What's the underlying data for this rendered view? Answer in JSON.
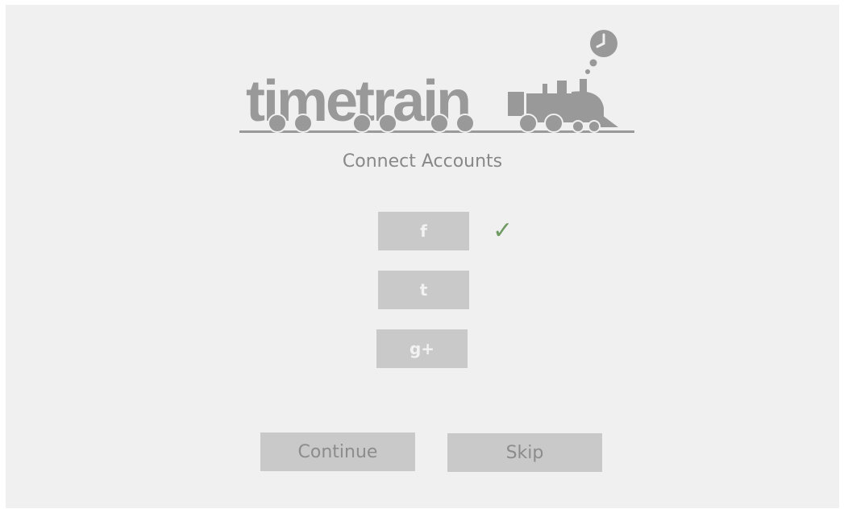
{
  "logo": {
    "wordmark": "timetrain",
    "color": "#999999"
  },
  "page_title": "Connect Accounts",
  "social_buttons": [
    {
      "glyph": "f",
      "service": "facebook",
      "connected": true
    },
    {
      "glyph": "t",
      "service": "twitter",
      "connected": false
    },
    {
      "glyph": "g+",
      "service": "google-plus",
      "connected": false
    }
  ],
  "connected_mark": "✓",
  "connected_color": "#6f9b63",
  "actions": {
    "continue_label": "Continue",
    "skip_label": "Skip"
  }
}
